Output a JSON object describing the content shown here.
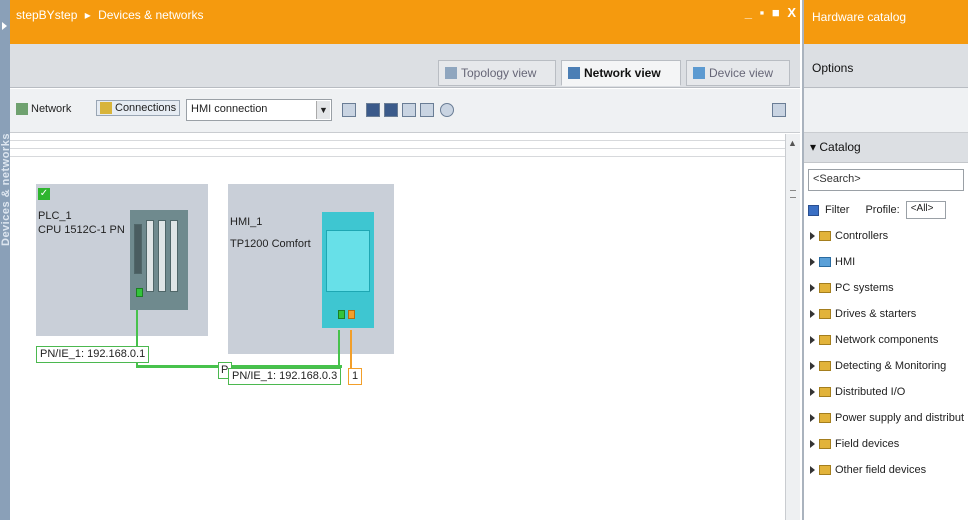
{
  "left_strip": {
    "label": "Devices & networks"
  },
  "editor": {
    "breadcrumb": [
      "stepBYstep",
      "▸",
      "Devices & networks"
    ],
    "window_controls": "_ ▪ ■ X",
    "views": [
      {
        "label": "Topology view",
        "icon": "topology-icon",
        "active": false
      },
      {
        "label": "Network view",
        "icon": "network-view-icon",
        "active": true
      },
      {
        "label": "Device view",
        "icon": "device-view-icon",
        "active": false
      }
    ],
    "toolbar": {
      "network_label": "Network",
      "connections_label": "Connections",
      "connection_type": "HMI connection"
    },
    "devices": [
      {
        "name": "PLC_1",
        "type": "CPU 1512C-1 PN",
        "address": "PN/IE_1: 192.168.0.1"
      },
      {
        "name": "HMI_1",
        "type": "TP1200 Comfort",
        "address": "PN/IE_1: 192.168.0.3",
        "address_prefix": "P",
        "port_label": "1"
      }
    ]
  },
  "catalog_panel": {
    "title": "Hardware catalog",
    "options_label": "Options",
    "catalog_label": "Catalog",
    "search_placeholder": "<Search>",
    "filter_label": "Filter",
    "profile_label": "Profile:",
    "profile_value": "<All>",
    "items": [
      "Controllers",
      "HMI",
      "PC systems",
      "Drives & starters",
      "Network components",
      "Detecting & Monitoring",
      "Distributed I/O",
      "Power supply and distribut",
      "Field devices",
      "Other field devices"
    ]
  },
  "colors": {
    "accent": "#f59a0e",
    "network": "#47c24c",
    "hmi": "#3ec6d1"
  }
}
